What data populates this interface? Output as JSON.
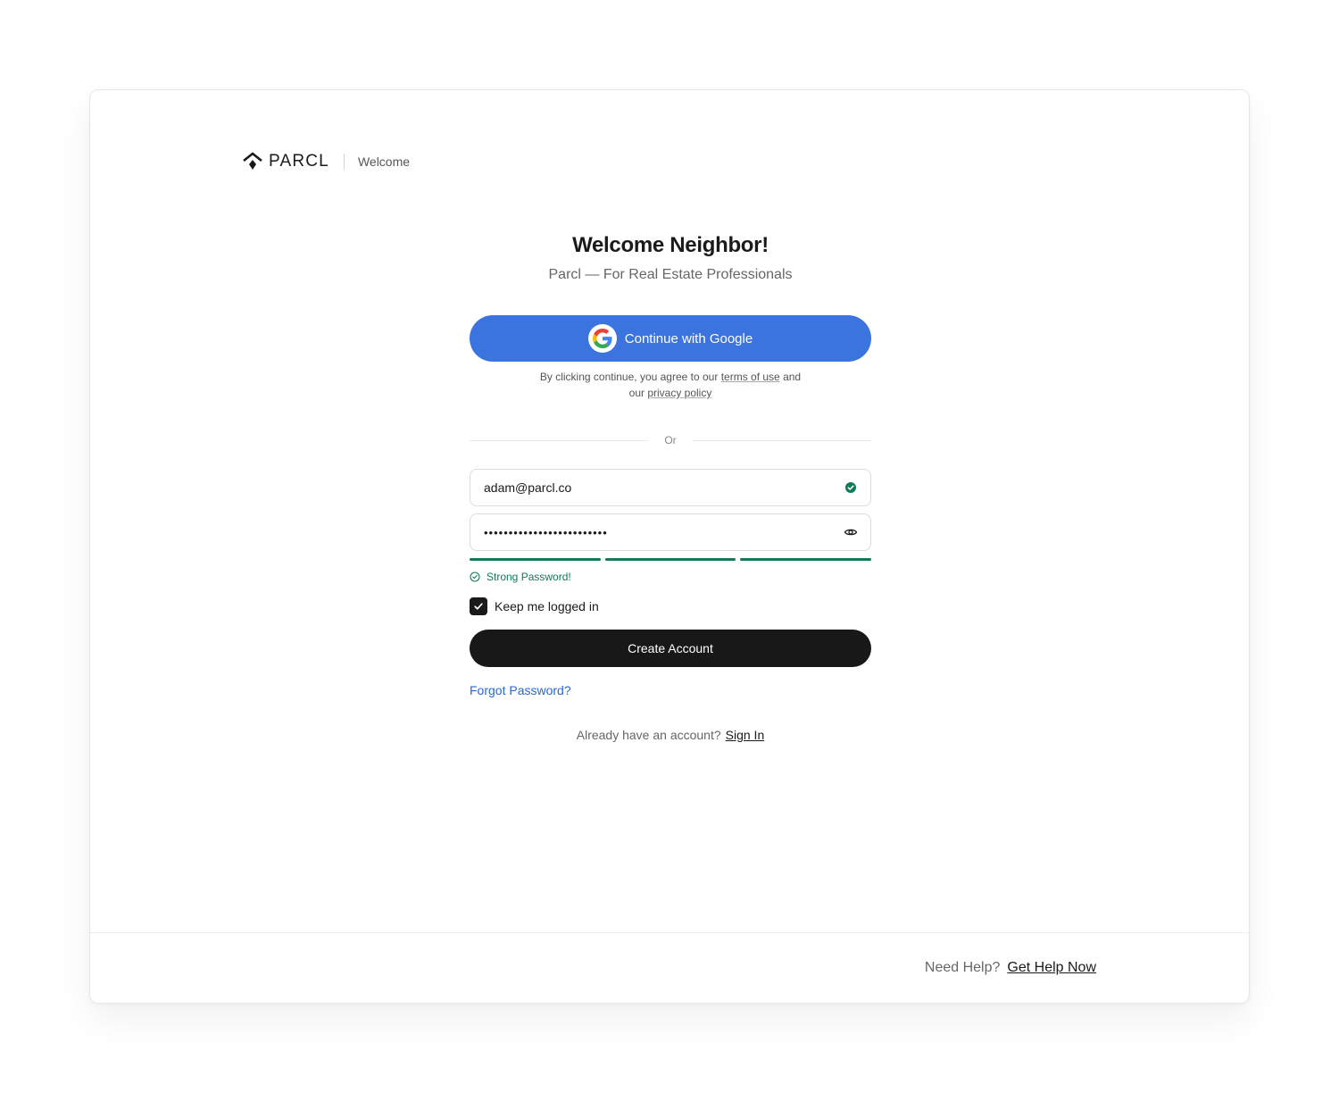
{
  "brand": {
    "logo_text": "PARCL",
    "page_label": "Welcome"
  },
  "heading": {
    "title": "Welcome Neighbor!",
    "subtitle": "Parcl — For Real Estate Professionals"
  },
  "google": {
    "button_label": "Continue with Google",
    "icon": "google-g-logo"
  },
  "terms": {
    "prefix": "By clicking continue, you agree to our",
    "terms_link": "terms of use",
    "middle": "and our",
    "privacy_link": "privacy policy"
  },
  "divider": {
    "label": "Or"
  },
  "form": {
    "email_value": "adam@parcl.co",
    "email_status_icon": "check-circle-icon",
    "password_value": "•••••••••••••••••••••••••",
    "password_toggle_icon": "eye-icon",
    "strength_level": 3,
    "strength_max": 3,
    "strength_color": "#0f7a55",
    "strength_message": "Strong Password!",
    "keep_logged_in_label": "Keep me logged in",
    "keep_logged_in_checked": true,
    "submit_label": "Create Account",
    "forgot_label": "Forgot Password?"
  },
  "signin": {
    "prompt": "Already have an account?",
    "link": "Sign In"
  },
  "footer": {
    "help_prompt": "Need Help?",
    "help_link": "Get Help Now"
  },
  "colors": {
    "google_blue": "#3b74df",
    "primary_dark": "#181818",
    "link_blue": "#2767d6",
    "success_green": "#0f7a55"
  }
}
